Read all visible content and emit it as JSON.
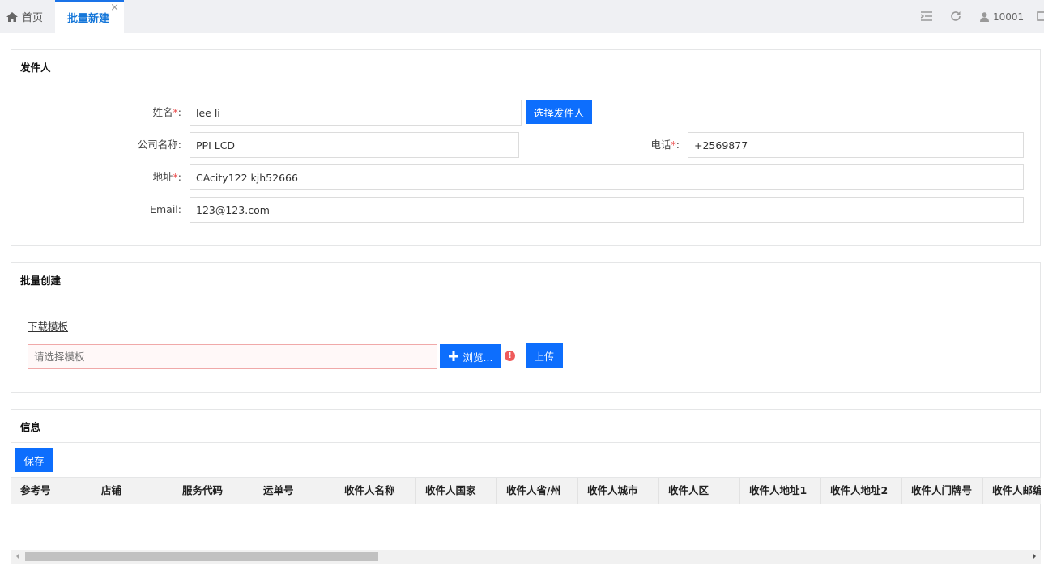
{
  "tabs": {
    "home": "首页",
    "active": "批量新建",
    "close": "×"
  },
  "toolbar": {
    "user_id": "10001"
  },
  "sender": {
    "title": "发件人",
    "name_label": "姓名",
    "name_value": "lee li",
    "select_button": "选择发件人",
    "company_label": "公司名称:",
    "company_value": "PPI LCD",
    "phone_label": "电话",
    "phone_value": "+2569877",
    "address_label": "地址",
    "address_value": "CAcity122 kjh52666",
    "email_label": "Email:",
    "email_value": "123@123.com",
    "required_mark": "*",
    "colon": ":"
  },
  "batch": {
    "title": "批量创建",
    "download_link": "下载模板",
    "file_placeholder": "请选择模板",
    "browse_button": "浏览...",
    "upload_button": "上传",
    "warning_mark": "!"
  },
  "info": {
    "title": "信息",
    "save_button": "保存",
    "columns": [
      "参考号",
      "店铺",
      "服务代码",
      "运单号",
      "收件人名称",
      "收件人国家",
      "收件人省/州",
      "收件人城市",
      "收件人区",
      "收件人地址1",
      "收件人地址2",
      "收件人门牌号",
      "收件人邮编"
    ]
  },
  "colors": {
    "primary": "#0d6efd",
    "active_tab": "#1677d9",
    "required": "#ec4c4c"
  }
}
